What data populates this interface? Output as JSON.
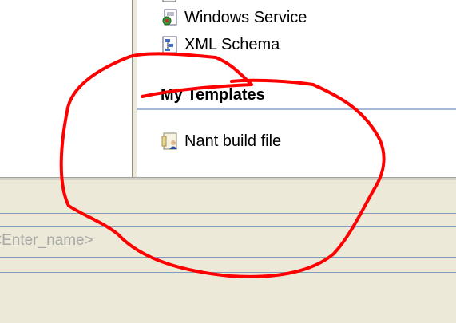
{
  "templates": {
    "items": [
      {
        "label": "Windows Service",
        "icon": "windows-service-icon"
      },
      {
        "label": "XML Schema",
        "icon": "xml-schema-icon"
      }
    ],
    "section_header": "My Templates",
    "my_items": [
      {
        "label": "Nant build file",
        "icon": "nant-build-file-icon"
      }
    ]
  },
  "form": {
    "name_placeholder": "<Enter_name>"
  },
  "annotation": {
    "color": "#ff0000",
    "shape": "hand-drawn-circle"
  }
}
